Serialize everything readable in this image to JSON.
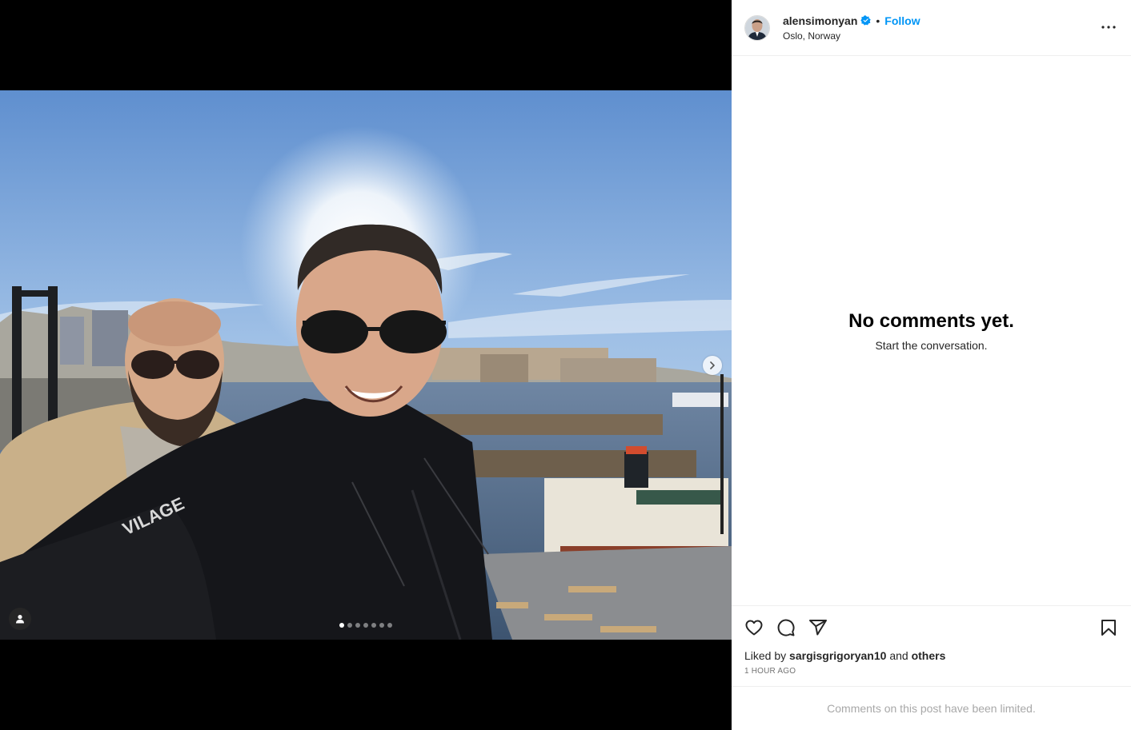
{
  "post": {
    "username": "alensimonyan",
    "separator": "•",
    "follow_label": "Follow",
    "location": "Oslo, Norway"
  },
  "media": {
    "slide_count": 7,
    "active_slide": 1
  },
  "comments": {
    "empty_title": "No comments yet.",
    "empty_subtitle": "Start the conversation."
  },
  "likes": {
    "prefix": "Liked by",
    "user": "sargisgrigoryan10",
    "middle": "and",
    "others": "others"
  },
  "timestamp": "1 HOUR AGO",
  "limited_notice": "Comments on this post have been limited.",
  "colors": {
    "follow": "#0095f6",
    "verified": "#0095f6",
    "muted": "#737373"
  },
  "icons": [
    "verified-badge-icon",
    "more-options-icon",
    "like-heart-icon",
    "comment-icon",
    "share-icon",
    "save-bookmark-icon",
    "next-arrow-icon",
    "user-tag-icon"
  ]
}
